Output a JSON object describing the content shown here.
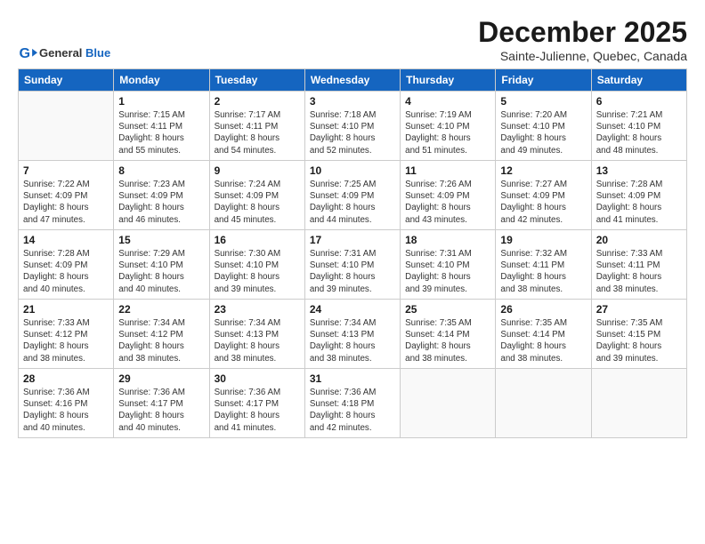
{
  "logo": {
    "general": "General",
    "blue": "Blue"
  },
  "title": "December 2025",
  "subtitle": "Sainte-Julienne, Quebec, Canada",
  "days_of_week": [
    "Sunday",
    "Monday",
    "Tuesday",
    "Wednesday",
    "Thursday",
    "Friday",
    "Saturday"
  ],
  "weeks": [
    [
      {
        "day": "",
        "info": ""
      },
      {
        "day": "1",
        "info": "Sunrise: 7:15 AM\nSunset: 4:11 PM\nDaylight: 8 hours\nand 55 minutes."
      },
      {
        "day": "2",
        "info": "Sunrise: 7:17 AM\nSunset: 4:11 PM\nDaylight: 8 hours\nand 54 minutes."
      },
      {
        "day": "3",
        "info": "Sunrise: 7:18 AM\nSunset: 4:10 PM\nDaylight: 8 hours\nand 52 minutes."
      },
      {
        "day": "4",
        "info": "Sunrise: 7:19 AM\nSunset: 4:10 PM\nDaylight: 8 hours\nand 51 minutes."
      },
      {
        "day": "5",
        "info": "Sunrise: 7:20 AM\nSunset: 4:10 PM\nDaylight: 8 hours\nand 49 minutes."
      },
      {
        "day": "6",
        "info": "Sunrise: 7:21 AM\nSunset: 4:10 PM\nDaylight: 8 hours\nand 48 minutes."
      }
    ],
    [
      {
        "day": "7",
        "info": "Sunrise: 7:22 AM\nSunset: 4:09 PM\nDaylight: 8 hours\nand 47 minutes."
      },
      {
        "day": "8",
        "info": "Sunrise: 7:23 AM\nSunset: 4:09 PM\nDaylight: 8 hours\nand 46 minutes."
      },
      {
        "day": "9",
        "info": "Sunrise: 7:24 AM\nSunset: 4:09 PM\nDaylight: 8 hours\nand 45 minutes."
      },
      {
        "day": "10",
        "info": "Sunrise: 7:25 AM\nSunset: 4:09 PM\nDaylight: 8 hours\nand 44 minutes."
      },
      {
        "day": "11",
        "info": "Sunrise: 7:26 AM\nSunset: 4:09 PM\nDaylight: 8 hours\nand 43 minutes."
      },
      {
        "day": "12",
        "info": "Sunrise: 7:27 AM\nSunset: 4:09 PM\nDaylight: 8 hours\nand 42 minutes."
      },
      {
        "day": "13",
        "info": "Sunrise: 7:28 AM\nSunset: 4:09 PM\nDaylight: 8 hours\nand 41 minutes."
      }
    ],
    [
      {
        "day": "14",
        "info": "Sunrise: 7:28 AM\nSunset: 4:09 PM\nDaylight: 8 hours\nand 40 minutes."
      },
      {
        "day": "15",
        "info": "Sunrise: 7:29 AM\nSunset: 4:10 PM\nDaylight: 8 hours\nand 40 minutes."
      },
      {
        "day": "16",
        "info": "Sunrise: 7:30 AM\nSunset: 4:10 PM\nDaylight: 8 hours\nand 39 minutes."
      },
      {
        "day": "17",
        "info": "Sunrise: 7:31 AM\nSunset: 4:10 PM\nDaylight: 8 hours\nand 39 minutes."
      },
      {
        "day": "18",
        "info": "Sunrise: 7:31 AM\nSunset: 4:10 PM\nDaylight: 8 hours\nand 39 minutes."
      },
      {
        "day": "19",
        "info": "Sunrise: 7:32 AM\nSunset: 4:11 PM\nDaylight: 8 hours\nand 38 minutes."
      },
      {
        "day": "20",
        "info": "Sunrise: 7:33 AM\nSunset: 4:11 PM\nDaylight: 8 hours\nand 38 minutes."
      }
    ],
    [
      {
        "day": "21",
        "info": "Sunrise: 7:33 AM\nSunset: 4:12 PM\nDaylight: 8 hours\nand 38 minutes."
      },
      {
        "day": "22",
        "info": "Sunrise: 7:34 AM\nSunset: 4:12 PM\nDaylight: 8 hours\nand 38 minutes."
      },
      {
        "day": "23",
        "info": "Sunrise: 7:34 AM\nSunset: 4:13 PM\nDaylight: 8 hours\nand 38 minutes."
      },
      {
        "day": "24",
        "info": "Sunrise: 7:34 AM\nSunset: 4:13 PM\nDaylight: 8 hours\nand 38 minutes."
      },
      {
        "day": "25",
        "info": "Sunrise: 7:35 AM\nSunset: 4:14 PM\nDaylight: 8 hours\nand 38 minutes."
      },
      {
        "day": "26",
        "info": "Sunrise: 7:35 AM\nSunset: 4:14 PM\nDaylight: 8 hours\nand 38 minutes."
      },
      {
        "day": "27",
        "info": "Sunrise: 7:35 AM\nSunset: 4:15 PM\nDaylight: 8 hours\nand 39 minutes."
      }
    ],
    [
      {
        "day": "28",
        "info": "Sunrise: 7:36 AM\nSunset: 4:16 PM\nDaylight: 8 hours\nand 40 minutes."
      },
      {
        "day": "29",
        "info": "Sunrise: 7:36 AM\nSunset: 4:17 PM\nDaylight: 8 hours\nand 40 minutes."
      },
      {
        "day": "30",
        "info": "Sunrise: 7:36 AM\nSunset: 4:17 PM\nDaylight: 8 hours\nand 41 minutes."
      },
      {
        "day": "31",
        "info": "Sunrise: 7:36 AM\nSunset: 4:18 PM\nDaylight: 8 hours\nand 42 minutes."
      },
      {
        "day": "",
        "info": ""
      },
      {
        "day": "",
        "info": ""
      },
      {
        "day": "",
        "info": ""
      }
    ]
  ]
}
